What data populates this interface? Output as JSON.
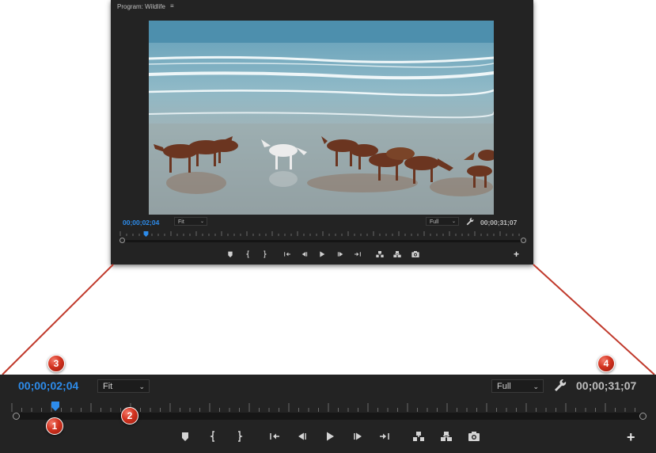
{
  "monitor": {
    "title": "Program: Wildlife",
    "menu_icon": "hamburger-icon",
    "playhead_time": "00;00;02;04",
    "zoom": "Fit",
    "resolution": "Full",
    "settings_icon": "wrench-icon",
    "duration": "00;00;31;07",
    "playhead_progress": 0.067,
    "buttons": [
      {
        "name": "add-marker-button",
        "icon": "marker-icon"
      },
      {
        "name": "mark-in-button",
        "icon": "mark-in-icon"
      },
      {
        "name": "mark-out-button",
        "icon": "mark-out-icon"
      },
      {
        "name": "go-to-in-button",
        "icon": "go-to-in-icon"
      },
      {
        "name": "step-back-button",
        "icon": "step-back-icon"
      },
      {
        "name": "play-button",
        "icon": "play-icon"
      },
      {
        "name": "step-forward-button",
        "icon": "step-forward-icon"
      },
      {
        "name": "go-to-out-button",
        "icon": "go-to-out-icon"
      },
      {
        "name": "lift-button",
        "icon": "lift-icon"
      },
      {
        "name": "extract-button",
        "icon": "extract-icon"
      },
      {
        "name": "export-frame-button",
        "icon": "camera-icon"
      }
    ],
    "add_button_label": "+"
  },
  "callouts": [
    "1",
    "2",
    "3",
    "4"
  ],
  "colors": {
    "panel_bg": "#232323",
    "timecode_blue": "#2d8ceb",
    "text_grey": "#bdbdbd",
    "callout_red": "#d2321f",
    "connector_red": "#c0392b"
  }
}
